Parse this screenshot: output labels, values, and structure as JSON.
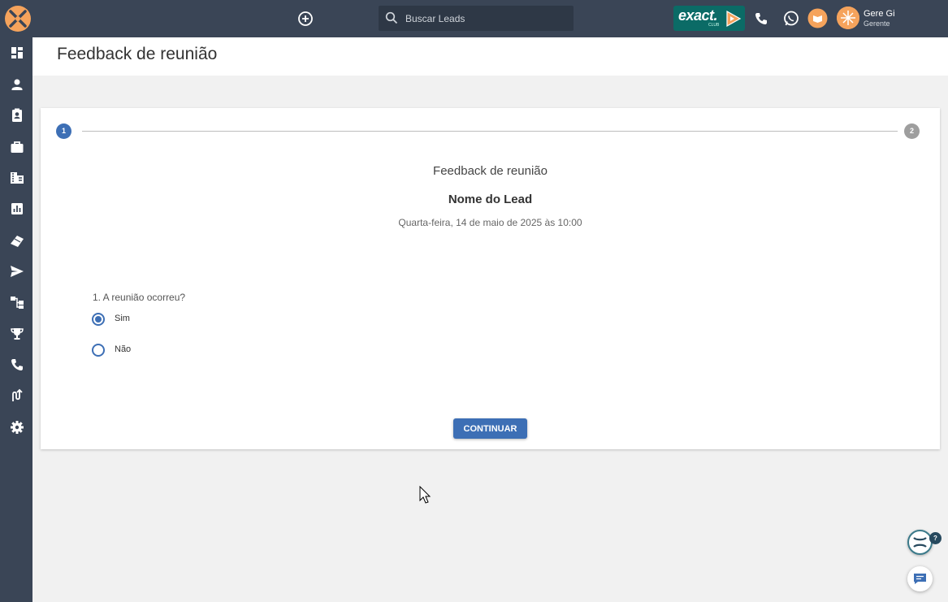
{
  "topbar": {
    "search_placeholder": "Buscar Leads",
    "club_label": "exact.",
    "club_sub": "CLUB",
    "user_name": "Gere Gi",
    "user_role": "Gerente"
  },
  "sidebar": {
    "items": [
      "dashboard-icon",
      "person-icon",
      "contacts-icon",
      "briefcase-icon",
      "building-icon",
      "chart-icon",
      "tags-icon",
      "send-icon",
      "workflow-icon",
      "trophy-icon",
      "phone-icon",
      "route-icon",
      "gear-icon"
    ]
  },
  "header": {
    "title": "Feedback de reunião"
  },
  "stepper": {
    "step1": "1",
    "step2": "2"
  },
  "card": {
    "subtitle": "Feedback de reunião",
    "lead_name": "Nome do Lead",
    "date": "Quarta-feira, 14 de maio de 2025 às 10:00",
    "question": "1. A reunião ocorreu?",
    "options": [
      {
        "label": "Sim",
        "selected": true
      },
      {
        "label": "Não",
        "selected": false
      }
    ],
    "continue_label": "CONTINUAR"
  },
  "floating": {
    "help_badge": "?"
  },
  "colors": {
    "primary": "#3d6fb5",
    "topbar": "#3a4556",
    "accent": "#f5a35c",
    "club": "#0b6b66"
  }
}
